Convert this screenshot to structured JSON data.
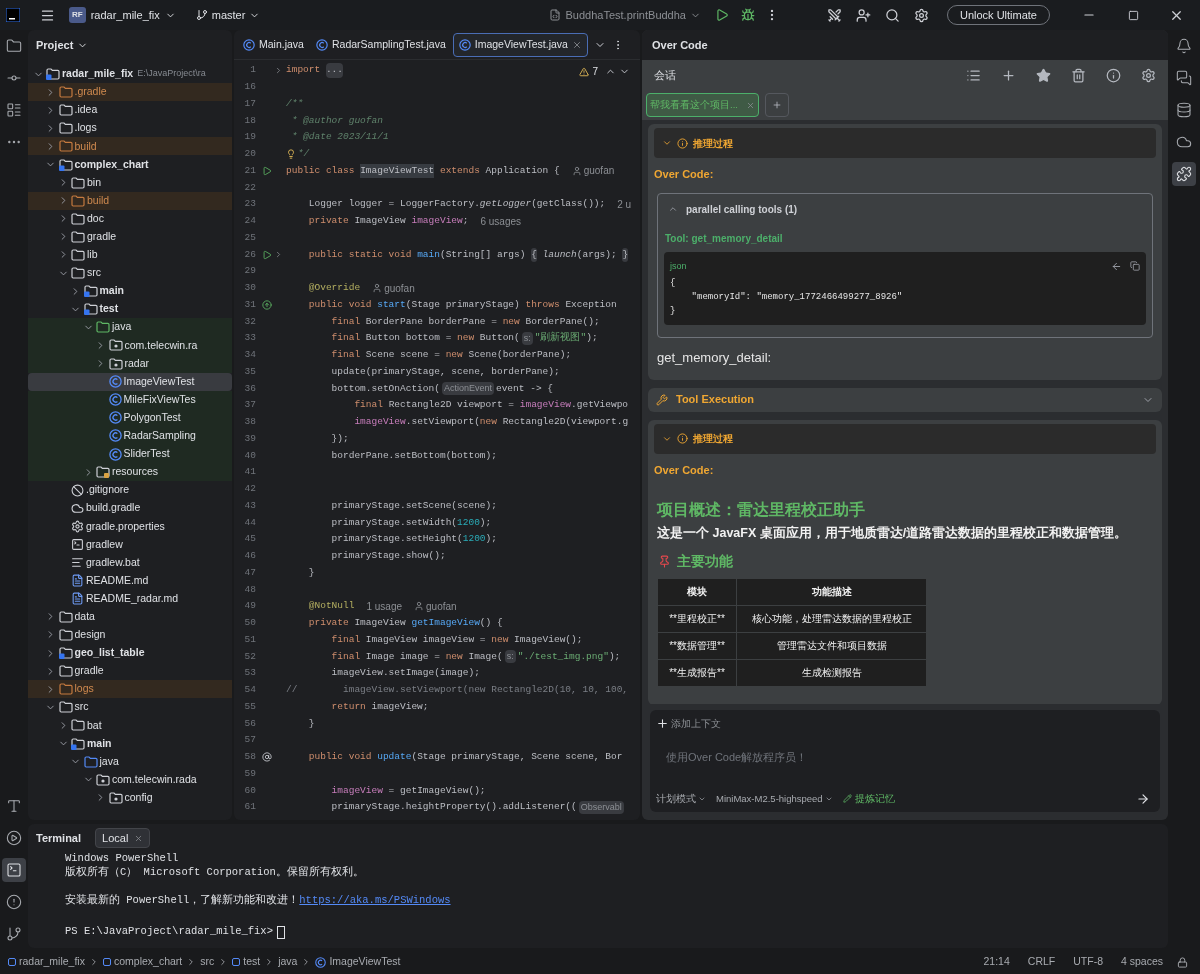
{
  "title_bar": {
    "project_badge": "RF",
    "project": "radar_mile_fix",
    "branch": "master",
    "run_config": "BuddhaTest.printBuddha",
    "upgrade_button": "Unlock Ultimate"
  },
  "left_tools": [
    {
      "kind": "project",
      "selected": false
    },
    {
      "kind": "commit",
      "selected": false
    },
    {
      "kind": "structure",
      "selected": false
    },
    {
      "kind": "more",
      "selected": false
    }
  ],
  "left_tools_bottom": [
    {
      "kind": "type",
      "selected": false
    },
    {
      "kind": "run",
      "selected": false
    },
    {
      "kind": "terminal",
      "selected": true
    },
    {
      "kind": "problems",
      "selected": false
    },
    {
      "kind": "git",
      "selected": false
    }
  ],
  "right_tools": [
    {
      "kind": "bell",
      "selected": false
    },
    {
      "kind": "chat",
      "selected": false
    },
    {
      "kind": "database",
      "selected": false
    },
    {
      "kind": "gradle",
      "selected": false
    },
    {
      "kind": "plugin",
      "selected": true
    }
  ],
  "project": {
    "title": "Project",
    "tree": [
      {
        "name": "radar_mile_fix",
        "hint": "E:\\JavaProject\\ra",
        "kind": "module",
        "expanded": true,
        "selected": false,
        "children": [
          {
            "name": ".gradle",
            "kind": "excluded_folder",
            "expanded": false,
            "selected": false
          },
          {
            "name": ".idea",
            "kind": "folder",
            "expanded": false,
            "selected": false
          },
          {
            "name": ".logs",
            "kind": "folder",
            "expanded": false,
            "selected": false
          },
          {
            "name": "build",
            "kind": "excluded_folder",
            "expanded": false,
            "selected": false
          },
          {
            "name": "complex_chart",
            "kind": "module",
            "expanded": true,
            "selected": false,
            "children": [
              {
                "name": "bin",
                "kind": "folder",
                "expanded": false,
                "selected": false
              },
              {
                "name": "build",
                "kind": "excluded_folder",
                "expanded": false,
                "selected": false
              },
              {
                "name": "doc",
                "kind": "folder",
                "expanded": false,
                "selected": false
              },
              {
                "name": "gradle",
                "kind": "folder",
                "expanded": false,
                "selected": false
              },
              {
                "name": "lib",
                "kind": "folder",
                "expanded": false,
                "selected": false
              },
              {
                "name": "src",
                "kind": "folder",
                "expanded": true,
                "selected": false,
                "children": [
                  {
                    "name": "main",
                    "kind": "module",
                    "expanded": false,
                    "selected": false
                  },
                  {
                    "name": "test",
                    "kind": "module",
                    "expanded": true,
                    "selected": false,
                    "children": [
                      {
                        "name": "java",
                        "kind": "test_root",
                        "expanded": true,
                        "selected": false,
                        "children": [
                          {
                            "name": "com.telecwin.ra",
                            "kind": "test_package",
                            "expanded": false,
                            "selected": false
                          },
                          {
                            "name": "radar",
                            "kind": "test_package",
                            "expanded": false,
                            "selected": false
                          },
                          {
                            "name": "ImageViewTest",
                            "kind": "test_class",
                            "selected": true
                          },
                          {
                            "name": "MileFixViewTes",
                            "kind": "test_class",
                            "selected": false
                          },
                          {
                            "name": "PolygonTest",
                            "kind": "test_class",
                            "selected": false
                          },
                          {
                            "name": "RadarSampling",
                            "kind": "test_class",
                            "selected": false
                          },
                          {
                            "name": "SliderTest",
                            "kind": "test_class",
                            "selected": false
                          }
                        ]
                      },
                      {
                        "name": "resources",
                        "kind": "test_resources",
                        "expanded": false,
                        "selected": false
                      }
                    ]
                  }
                ]
              },
              {
                "name": ".gitignore",
                "kind": "ignore",
                "selected": false
              },
              {
                "name": "build.gradle",
                "kind": "gradle",
                "selected": false
              },
              {
                "name": "gradle.properties",
                "kind": "properties",
                "selected": false
              },
              {
                "name": "gradlew",
                "kind": "shell",
                "selected": false
              },
              {
                "name": "gradlew.bat",
                "kind": "bat",
                "selected": false
              },
              {
                "name": "README.md",
                "kind": "md",
                "selected": false
              },
              {
                "name": "README_radar.md",
                "kind": "md",
                "selected": false
              }
            ]
          },
          {
            "name": "data",
            "kind": "folder",
            "expanded": false,
            "selected": false
          },
          {
            "name": "design",
            "kind": "folder",
            "expanded": false,
            "selected": false
          },
          {
            "name": "geo_list_table",
            "kind": "module",
            "expanded": false,
            "selected": false
          },
          {
            "name": "gradle",
            "kind": "folder",
            "expanded": false,
            "selected": false
          },
          {
            "name": "logs",
            "kind": "excluded_folder",
            "expanded": false,
            "selected": false
          },
          {
            "name": "src",
            "kind": "folder",
            "expanded": true,
            "selected": false,
            "children": [
              {
                "name": "bat",
                "kind": "folder",
                "expanded": false,
                "selected": false
              },
              {
                "name": "main",
                "kind": "module",
                "expanded": true,
                "selected": false,
                "children": [
                  {
                    "name": "java",
                    "kind": "source_root",
                    "expanded": true,
                    "selected": false,
                    "children": [
                      {
                        "name": "com.telecwin.rada",
                        "kind": "package",
                        "expanded": true,
                        "selected": false,
                        "children": [
                          {
                            "name": "config",
                            "kind": "package",
                            "expanded": false,
                            "selected": false
                          }
                        ]
                      }
                    ]
                  }
                ]
              }
            ]
          }
        ]
      }
    ]
  },
  "editor": {
    "tabs": [
      {
        "label": "Main.java",
        "selected": false
      },
      {
        "label": "RadarSamplingTest.java",
        "selected": false
      },
      {
        "label": "ImageViewTest.java",
        "selected": true
      }
    ],
    "warnings": "7",
    "lines": [
      {
        "n": "1",
        "kind": "fold",
        "t": [
          {
            "kind": "kw",
            "text": "import "
          },
          {
            "kind": "fold",
            "text": "..."
          }
        ]
      },
      {
        "n": "16",
        "kind": "plain"
      },
      {
        "n": "17",
        "kind": "plain",
        "t": [
          {
            "kind": "doc",
            "text": "/**"
          }
        ]
      },
      {
        "n": "18",
        "kind": "plain",
        "t": [
          {
            "kind": "doc",
            "text": " * @author guofan"
          }
        ]
      },
      {
        "n": "19",
        "kind": "plain",
        "t": [
          {
            "kind": "doc",
            "text": " * @date 2023/11/1"
          }
        ]
      },
      {
        "n": "20",
        "kind": "bulb",
        "t": [
          {
            "kind": "doc",
            "text": " */"
          }
        ]
      },
      {
        "n": "21",
        "kind": "run",
        "t": [
          {
            "kind": "kw",
            "text": "public class "
          },
          {
            "kind": "mark",
            "text": "ImageViewTest"
          },
          {
            "kind": "kw",
            "text": " extends "
          },
          {
            "kind": "plain",
            "text": "Application {"
          },
          {
            "kind": "author",
            "text": "guofan"
          }
        ]
      },
      {
        "n": "22",
        "kind": "plain"
      },
      {
        "n": "23",
        "kind": "plain",
        "t": [
          {
            "kind": "plain",
            "text": "    Logger logger = LoggerFactory."
          },
          {
            "kind": "it",
            "text": "getLogger"
          },
          {
            "kind": "plain",
            "text": "(getClass());"
          },
          {
            "kind": "usage",
            "text": "2 u"
          }
        ]
      },
      {
        "n": "24",
        "kind": "plain",
        "t": [
          {
            "kind": "kw",
            "text": "    private "
          },
          {
            "kind": "plain",
            "text": "ImageView "
          },
          {
            "kind": "field",
            "text": "imageView"
          },
          {
            "kind": "plain",
            "text": ";"
          },
          {
            "kind": "usage",
            "text": "6 usages"
          }
        ]
      },
      {
        "n": "25",
        "kind": "plain"
      },
      {
        "n": "26",
        "kind": "run_fold",
        "t": [
          {
            "kind": "kw",
            "text": "    public static void "
          },
          {
            "kind": "fn",
            "text": "main"
          },
          {
            "kind": "plain",
            "text": "(String[] args) "
          },
          {
            "kind": "fold",
            "text": "{"
          },
          {
            "kind": "it",
            "text": " launch"
          },
          {
            "kind": "plain",
            "text": "(args); "
          },
          {
            "kind": "fold",
            "text": "}"
          }
        ]
      },
      {
        "n": "29",
        "kind": "plain"
      },
      {
        "n": "30",
        "kind": "plain",
        "t": [
          {
            "kind": "ann",
            "text": "    @Override"
          },
          {
            "kind": "author",
            "text": "guofan"
          }
        ]
      },
      {
        "n": "31",
        "kind": "override",
        "t": [
          {
            "kind": "kw",
            "text": "    public void "
          },
          {
            "kind": "fn",
            "text": "start"
          },
          {
            "kind": "plain",
            "text": "(Stage primaryStage) "
          },
          {
            "kind": "kw",
            "text": "throws "
          },
          {
            "kind": "plain",
            "text": "Exception"
          }
        ]
      },
      {
        "n": "32",
        "kind": "plain",
        "t": [
          {
            "kind": "kw",
            "text": "        final "
          },
          {
            "kind": "plain",
            "text": "BorderPane borderPane = "
          },
          {
            "kind": "kw",
            "text": "new "
          },
          {
            "kind": "plain",
            "text": "BorderPane();"
          }
        ]
      },
      {
        "n": "33",
        "kind": "plain",
        "t": [
          {
            "kind": "kw",
            "text": "        final "
          },
          {
            "kind": "plain",
            "text": "Button bottom = "
          },
          {
            "kind": "kw",
            "text": "new "
          },
          {
            "kind": "plain",
            "text": "Button("
          },
          {
            "kind": "hint",
            "text": "s:"
          },
          {
            "kind": "str",
            "text": "\"刷新视图\""
          },
          {
            "kind": "plain",
            "text": ");"
          }
        ]
      },
      {
        "n": "34",
        "kind": "plain",
        "t": [
          {
            "kind": "kw",
            "text": "        final "
          },
          {
            "kind": "plain",
            "text": "Scene scene = "
          },
          {
            "kind": "kw",
            "text": "new "
          },
          {
            "kind": "plain",
            "text": "Scene(borderPane);"
          }
        ]
      },
      {
        "n": "35",
        "kind": "plain",
        "t": [
          {
            "kind": "plain",
            "text": "        update(primaryStage, scene, borderPane);"
          }
        ]
      },
      {
        "n": "36",
        "kind": "plain",
        "t": [
          {
            "kind": "plain",
            "text": "        bottom.setOnAction("
          },
          {
            "kind": "hint",
            "text": "ActionEvent"
          },
          {
            "kind": "plain",
            "text": "event -> {"
          }
        ]
      },
      {
        "n": "37",
        "kind": "plain",
        "t": [
          {
            "kind": "kw",
            "text": "            final "
          },
          {
            "kind": "plain",
            "text": "Rectangle2D viewport = "
          },
          {
            "kind": "field",
            "text": "imageView"
          },
          {
            "kind": "plain",
            "text": ".getViewpo"
          }
        ]
      },
      {
        "n": "38",
        "kind": "plain",
        "t": [
          {
            "kind": "field",
            "text": "            imageView"
          },
          {
            "kind": "plain",
            "text": ".setViewport("
          },
          {
            "kind": "kw",
            "text": "new "
          },
          {
            "kind": "plain",
            "text": "Rectangle2D(viewport.g"
          }
        ]
      },
      {
        "n": "39",
        "kind": "plain",
        "t": [
          {
            "kind": "plain",
            "text": "        });"
          }
        ]
      },
      {
        "n": "40",
        "kind": "plain",
        "t": [
          {
            "kind": "plain",
            "text": "        borderPane.setBottom(bottom);"
          }
        ]
      },
      {
        "n": "41",
        "kind": "plain"
      },
      {
        "n": "42",
        "kind": "plain"
      },
      {
        "n": "43",
        "kind": "plain",
        "t": [
          {
            "kind": "plain",
            "text": "        primaryStage.setScene(scene);"
          }
        ]
      },
      {
        "n": "44",
        "kind": "plain",
        "t": [
          {
            "kind": "plain",
            "text": "        primaryStage.setWidth("
          },
          {
            "kind": "num",
            "text": "1200"
          },
          {
            "kind": "plain",
            "text": ");"
          }
        ]
      },
      {
        "n": "45",
        "kind": "plain",
        "t": [
          {
            "kind": "plain",
            "text": "        primaryStage.setHeight("
          },
          {
            "kind": "num",
            "text": "1200"
          },
          {
            "kind": "plain",
            "text": ");"
          }
        ]
      },
      {
        "n": "46",
        "kind": "plain",
        "t": [
          {
            "kind": "plain",
            "text": "        primaryStage.show();"
          }
        ]
      },
      {
        "n": "47",
        "kind": "plain",
        "t": [
          {
            "kind": "plain",
            "text": "    }"
          }
        ]
      },
      {
        "n": "48",
        "kind": "plain"
      },
      {
        "n": "49",
        "kind": "plain",
        "t": [
          {
            "kind": "ann",
            "text": "    @NotNull"
          },
          {
            "kind": "usage",
            "text": "1 usage"
          },
          {
            "kind": "author",
            "text": "guofan"
          }
        ]
      },
      {
        "n": "50",
        "kind": "plain",
        "t": [
          {
            "kind": "kw",
            "text": "    private "
          },
          {
            "kind": "plain",
            "text": "ImageView "
          },
          {
            "kind": "fn",
            "text": "getImageView"
          },
          {
            "kind": "plain",
            "text": "() {"
          }
        ]
      },
      {
        "n": "51",
        "kind": "plain",
        "t": [
          {
            "kind": "kw",
            "text": "        final "
          },
          {
            "kind": "plain",
            "text": "ImageView imageView = "
          },
          {
            "kind": "kw",
            "text": "new "
          },
          {
            "kind": "plain",
            "text": "ImageView();"
          }
        ]
      },
      {
        "n": "52",
        "kind": "plain",
        "t": [
          {
            "kind": "kw",
            "text": "        final "
          },
          {
            "kind": "plain",
            "text": "Image image = "
          },
          {
            "kind": "kw",
            "text": "new "
          },
          {
            "kind": "plain",
            "text": "Image("
          },
          {
            "kind": "hint",
            "text": "s:"
          },
          {
            "kind": "str",
            "text": "\"./test_img.png\""
          },
          {
            "kind": "plain",
            "text": ");"
          }
        ]
      },
      {
        "n": "53",
        "kind": "plain",
        "t": [
          {
            "kind": "plain",
            "text": "        imageView.setImage(image);"
          }
        ]
      },
      {
        "n": "54",
        "kind": "plain",
        "t": [
          {
            "kind": "cm",
            "text": "//        imageView.setViewport(new Rectangle2D(10, 10, 100,"
          }
        ]
      },
      {
        "n": "55",
        "kind": "plain",
        "t": [
          {
            "kind": "kw",
            "text": "        return "
          },
          {
            "kind": "plain",
            "text": "imageView;"
          }
        ]
      },
      {
        "n": "56",
        "kind": "plain",
        "t": [
          {
            "kind": "plain",
            "text": "    }"
          }
        ]
      },
      {
        "n": "57",
        "kind": "plain"
      },
      {
        "n": "58",
        "kind": "at",
        "t": [
          {
            "kind": "kw",
            "text": "    public void "
          },
          {
            "kind": "fn",
            "text": "update"
          },
          {
            "kind": "plain",
            "text": "(Stage primaryStage, Scene scene, Bor"
          }
        ]
      },
      {
        "n": "59",
        "kind": "plain"
      },
      {
        "n": "60",
        "kind": "plain",
        "t": [
          {
            "kind": "field",
            "text": "        imageView"
          },
          {
            "kind": "plain",
            "text": " = getImageView();"
          }
        ]
      },
      {
        "n": "61",
        "kind": "plain",
        "t": [
          {
            "kind": "plain",
            "text": "        primaryStage.heightProperty().addListener(("
          },
          {
            "kind": "hint",
            "text": "Observabl"
          }
        ]
      }
    ]
  },
  "chat": {
    "title": "Over Code",
    "section": "会话",
    "tabs": [
      {
        "label": "帮我看看这个项目...",
        "selected": true
      }
    ],
    "blocks": [
      {
        "kind": "card",
        "items": [
          {
            "kind": "reasoning",
            "label": "推理过程",
            "expanded": true
          },
          {
            "kind": "sender",
            "text": "Over Code:"
          },
          {
            "kind": "tools",
            "title": "parallel calling tools (1)",
            "expanded": true,
            "tool": "Tool: get_memory_detail",
            "lang": "json",
            "code": [
              "{",
              "    \"memoryId\": \"memory_1772466499277_8926\"",
              "}"
            ]
          },
          {
            "kind": "text",
            "text": "get_memory_detail:"
          }
        ]
      },
      {
        "kind": "bar",
        "label": "Tool Execution",
        "expanded": false
      },
      {
        "kind": "card",
        "items": [
          {
            "kind": "reasoning",
            "label": "推理过程",
            "expanded": true
          },
          {
            "kind": "sender",
            "text": "Over Code:"
          },
          {
            "kind": "heading",
            "text": "项目概述：雷达里程校正助手"
          },
          {
            "kind": "paragraph",
            "text": "这是一个 JavaFX 桌面应用，用于地质雷达/道路雷达数据的里程校正和数据管理。"
          },
          {
            "kind": "subheading",
            "text": "主要功能"
          },
          {
            "kind": "table",
            "columns": [
              "模块",
              "功能描述"
            ],
            "rows": [
              [
                "**里程校正**",
                "核心功能，处理雷达数据的里程校正"
              ],
              [
                "**数据管理**",
                "管理雷达文件和项目数据"
              ],
              [
                "**生成报告**",
                "生成检测报告"
              ]
            ]
          }
        ]
      }
    ],
    "input": {
      "add_context": "添加上下文",
      "placeholder": "使用Over Code解放程序员！",
      "mode": "计划模式",
      "model": "MiniMax-M2.5-highspeed",
      "memory": "提炼记忆"
    }
  },
  "terminal": {
    "title": "Terminal",
    "tabs": [
      {
        "label": "Local",
        "selected": true
      }
    ],
    "groups": [
      {
        "lines": [
          {
            "text": "Windows PowerShell"
          },
          {
            "text": "版权所有（C） Microsoft Corporation。保留所有权利。"
          }
        ]
      },
      {
        "lines": [
          {
            "text": "安装最新的 PowerShell，了解新功能和改进！",
            "link": "https://aka.ms/PSWindows"
          }
        ]
      }
    ],
    "prompt": "PS E:\\JavaProject\\radar_mile_fix>"
  },
  "status_bar": {
    "breadcrumbs": [
      {
        "label": "radar_mile_fix",
        "kind": "module"
      },
      {
        "label": "complex_chart",
        "kind": "module"
      },
      {
        "label": "src",
        "kind": "folder"
      },
      {
        "label": "test",
        "kind": "module"
      },
      {
        "label": "java",
        "kind": "folder"
      },
      {
        "label": "ImageViewTest",
        "kind": "class"
      }
    ],
    "items": [
      "21:14",
      "CRLF",
      "UTF-8",
      "4 spaces"
    ]
  }
}
